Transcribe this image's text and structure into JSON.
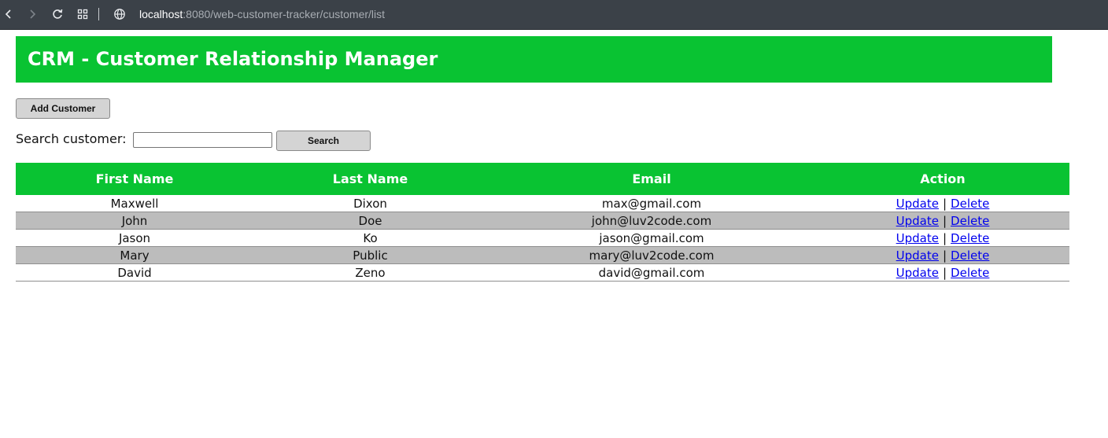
{
  "browser": {
    "url_host": "localhost",
    "url_path": ":8080/web-customer-tracker/customer/list"
  },
  "header": {
    "title": "CRM - Customer Relationship Manager"
  },
  "actions": {
    "add_label": "Add Customer",
    "search_label": "Search customer:",
    "search_value": "",
    "search_button": "Search"
  },
  "table": {
    "columns": [
      "First Name",
      "Last Name",
      "Email",
      "Action"
    ],
    "update_label": "Update",
    "delete_label": "Delete",
    "separator": "|",
    "rows": [
      {
        "first": "Maxwell",
        "last": "Dixon",
        "email": "max@gmail.com"
      },
      {
        "first": "John",
        "last": "Doe",
        "email": "john@luv2code.com"
      },
      {
        "first": "Jason",
        "last": "Ko",
        "email": "jason@gmail.com"
      },
      {
        "first": "Mary",
        "last": "Public",
        "email": "mary@luv2code.com"
      },
      {
        "first": "David",
        "last": "Zeno",
        "email": "david@gmail.com"
      }
    ]
  },
  "colors": {
    "header_green": "#09c332",
    "alt_row": "#bcbcbc",
    "link": "#0000ee"
  }
}
